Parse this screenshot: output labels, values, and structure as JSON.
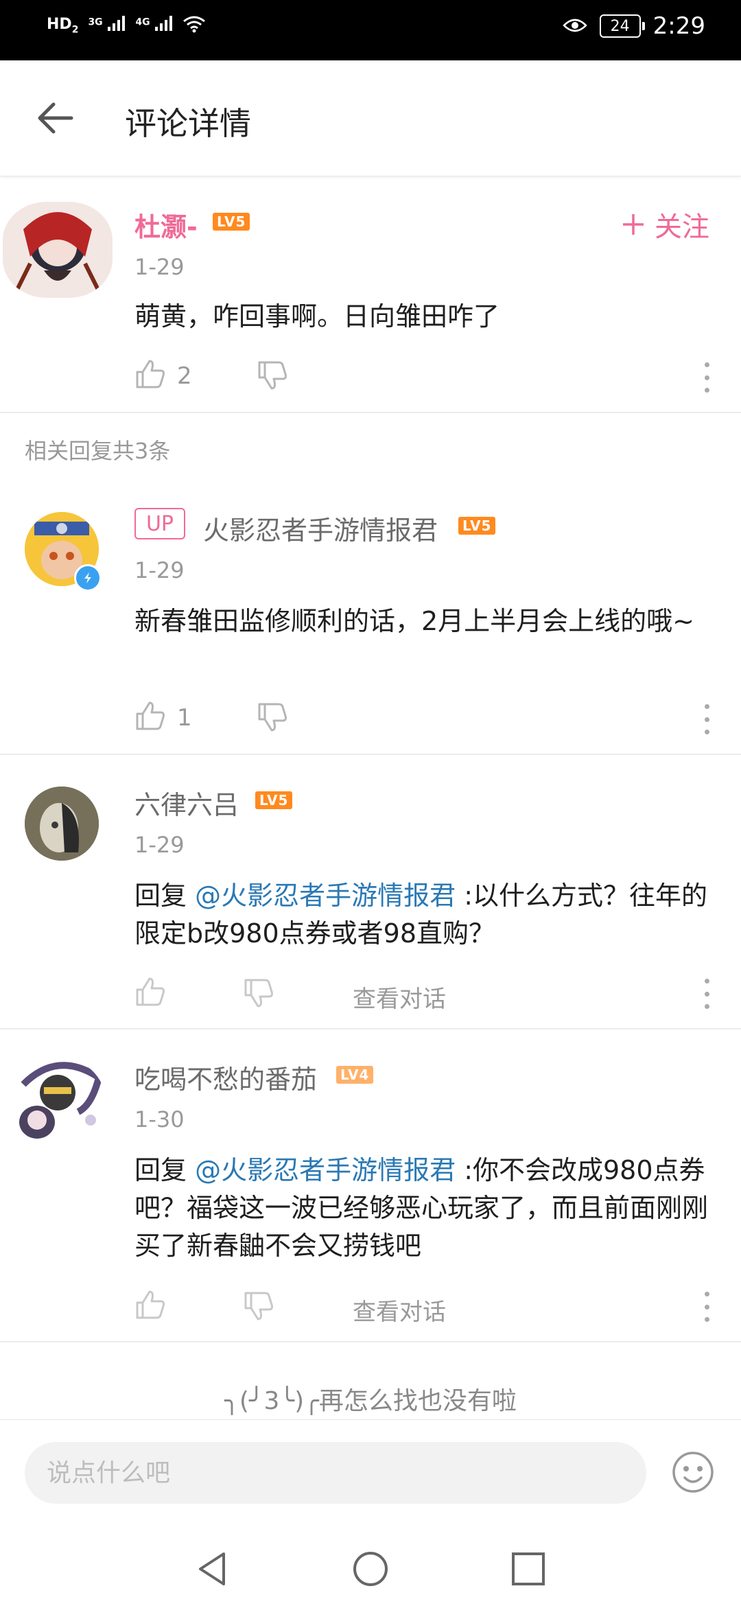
{
  "status_bar": {
    "network": "HD",
    "sim_slot": "2",
    "sig1": "3G",
    "sig2": "4G",
    "battery": "24",
    "time": "2:29"
  },
  "header": {
    "title": "评论详情"
  },
  "main_comment": {
    "username": "杜灏-",
    "level": "LV5",
    "date": "1-29",
    "content": "萌黄，咋回事啊。日向雏田咋了",
    "likes": "2",
    "follow_label": "关注"
  },
  "related": {
    "label": "相关回复共3条"
  },
  "replies": [
    {
      "badge": "UP",
      "username": "火影忍者手游情报君",
      "level": "LV5",
      "date": "1-29",
      "content": "新春雏田监修顺利的话，2月上半月会上线的哦~",
      "likes": "1"
    },
    {
      "username": "六律六吕",
      "level": "LV5",
      "date": "1-29",
      "reply_prefix": "回复 ",
      "mention": "@火影忍者手游情报君",
      "content": " :以什么方式？往年的限定b改980点券或者98直购？",
      "view_conversation": "查看对话"
    },
    {
      "username": "吃喝不愁的番茄",
      "level": "LV4",
      "date": "1-30",
      "reply_prefix": "回复 ",
      "mention": "@火影忍者手游情报君",
      "content": " :你不会改成980点券吧？福袋这一波已经够恶心玩家了，而且前面刚刚买了新春鼬不会又捞钱吧",
      "view_conversation": "查看对话"
    }
  ],
  "end_text": "╮(╯3╰)╭再怎么找也没有啦",
  "input": {
    "placeholder": "说点什么吧"
  },
  "colors": {
    "accent_pink": "#f06a97",
    "mention_blue": "#2a79b4",
    "level_orange": "#ff8a1f"
  }
}
